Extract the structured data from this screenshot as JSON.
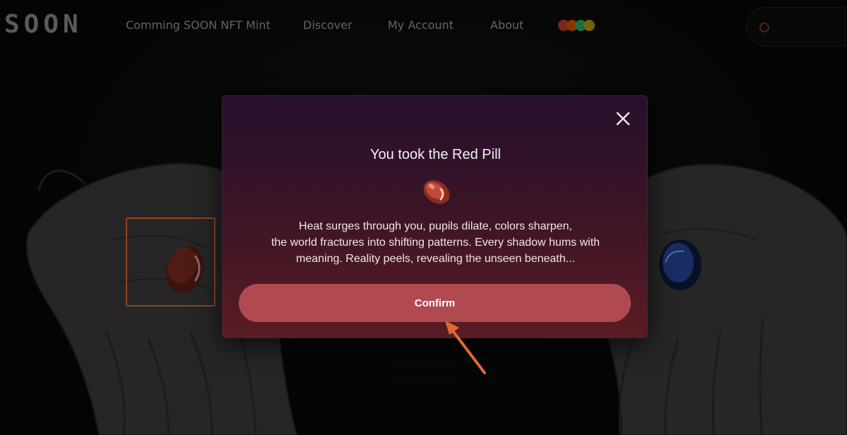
{
  "nav": {
    "logo": "SOON",
    "links": [
      "Comming SOON NFT Mint",
      "Discover",
      "My Account",
      "About"
    ],
    "wallet_badge_icon": "wallet-icon",
    "connect_icon": "wallet-connect-icon"
  },
  "modal": {
    "title": "You took the Red Pill",
    "body_lines": [
      "Heat surges through you, pupils dilate, colors sharpen,",
      "the world fractures into shifting patterns. Every shadow hums with",
      "meaning. Reality peels, revealing the unseen beneath..."
    ],
    "confirm_label": "Confirm",
    "close_icon": "close-icon",
    "pill_icon": "red-pill-icon"
  },
  "colors": {
    "accent_orange": "#e06a33",
    "confirm_button": "#b14a50",
    "modal_top": "#26102e",
    "modal_bottom": "#5a1c24",
    "red_pill": "#c24a3a",
    "blue_pill": "#2f55b8"
  }
}
